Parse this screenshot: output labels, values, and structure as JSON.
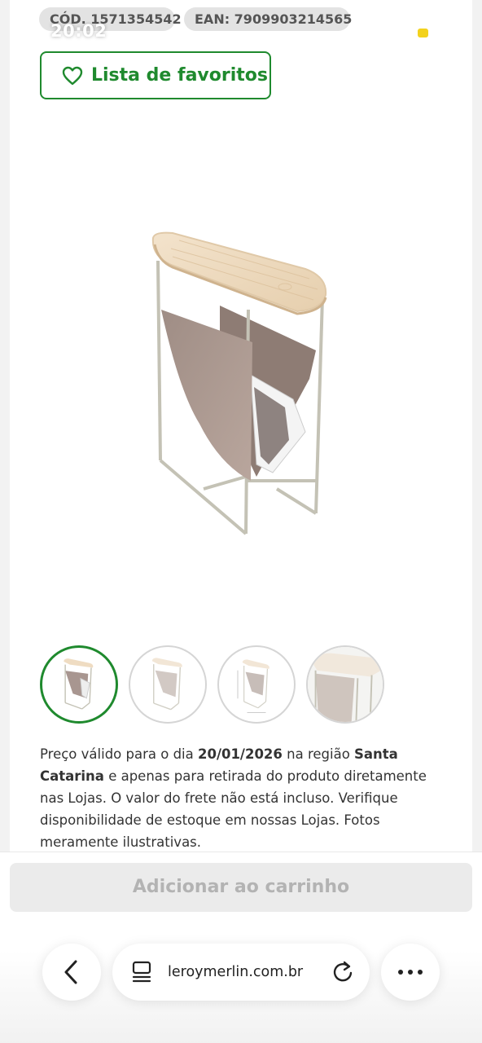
{
  "status_bar": {
    "time": "20:02"
  },
  "product": {
    "cod_label": "CÓD. 1571354542",
    "ean_label": "EAN: 7909903214565",
    "favorites_label": "Lista de favoritos",
    "image_icon": "side-table-magazine-rack"
  },
  "notice": {
    "p1": "Preço válido para o dia ",
    "date": "20/01/2026",
    "p2": " na região ",
    "region": "Santa Catarina",
    "p3": " e apenas para retirada do produto diretamente nas Lojas. O valor do frete não está incluso. Verifique disponibilidade de estoque em nossas Lojas. Fotos meramente ilustrativas."
  },
  "cart": {
    "label": "Adicionar ao carrinho"
  },
  "browser": {
    "url": "leroymerlin.com.br"
  },
  "colors": {
    "brand_green": "#1f8a2e",
    "disabled_bg": "#ebebeb",
    "disabled_text": "#b3b3b3"
  }
}
